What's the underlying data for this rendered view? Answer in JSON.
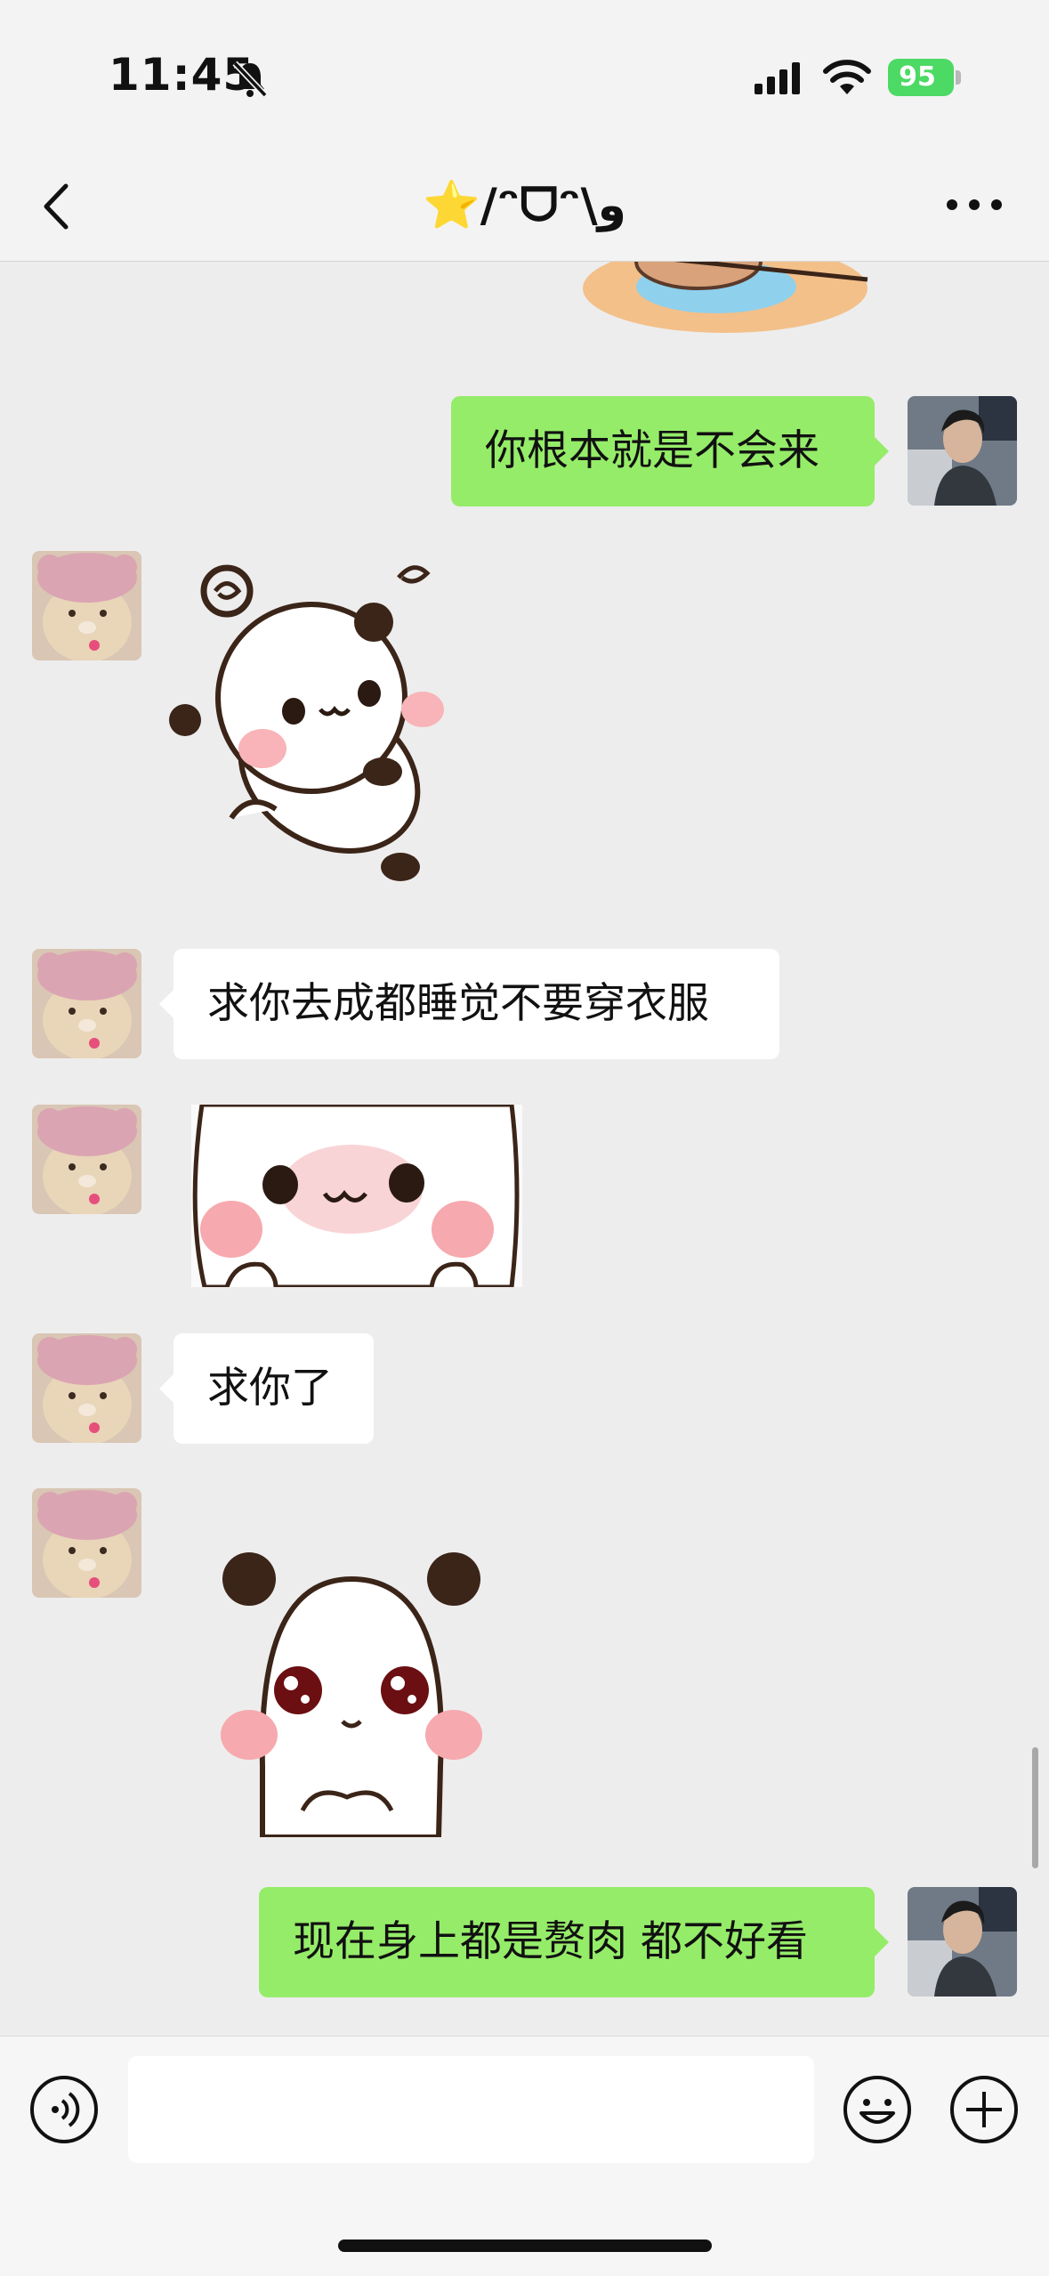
{
  "status_bar": {
    "time": "11:45",
    "battery": "95",
    "icons": [
      "bell-muted-icon",
      "signal-icon",
      "wifi-icon",
      "battery-charging-icon"
    ]
  },
  "header": {
    "title": "⭐️/ᵔᗜᵔ\\و",
    "back_icon": "chevron-left-icon",
    "more_icon": "ellipsis-icon"
  },
  "messages": [
    {
      "from": "me",
      "type": "text",
      "text": "你根本就是不会来"
    },
    {
      "from": "contact",
      "type": "sticker",
      "description_icon": "panda-sticker-icon"
    },
    {
      "from": "contact",
      "type": "text",
      "text": "求你去成都睡觉不要穿衣服"
    },
    {
      "from": "contact",
      "type": "sticker",
      "description_icon": "blushing-panda-sticker-icon"
    },
    {
      "from": "contact",
      "type": "text",
      "text": "求你了"
    },
    {
      "from": "contact",
      "type": "sticker",
      "description_icon": "sitting-panda-sticker-icon"
    },
    {
      "from": "me",
      "type": "text",
      "text": "现在身上都是赘肉 都不好看"
    }
  ],
  "input_bar": {
    "placeholder": "",
    "voice_icon": "voice-icon",
    "emoji_icon": "smiley-icon",
    "plus_icon": "plus-icon"
  },
  "colors": {
    "my_bubble": "#95ec69",
    "their_bubble": "#ffffff",
    "background": "#ededed"
  }
}
